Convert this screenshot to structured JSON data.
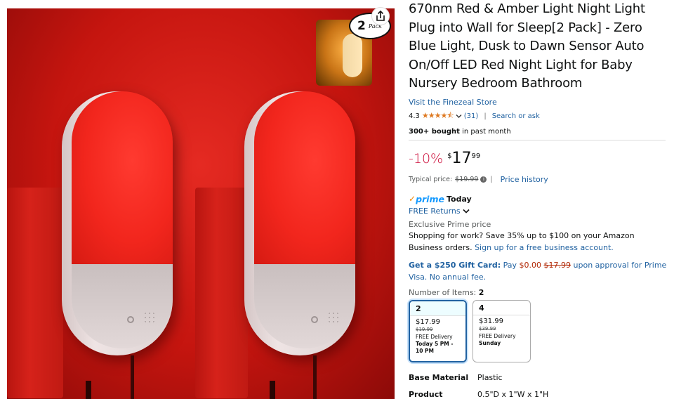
{
  "gallery": {
    "badge_number": "2",
    "badge_word": "Pack",
    "share_icon": "share-icon"
  },
  "product": {
    "title": "670nm Red & Amber Light Night Light Plug into Wall for Sleep[2 Pack] - Zero Blue Light, Dusk to Dawn Sensor Auto On/Off LED Red Night Light for Baby Nursery Bedroom Bathroom",
    "store_link": "Visit the Finezeal Store",
    "rating_value": "4.3",
    "rating_stars": "★★★★⯪",
    "rating_count": "(31)",
    "search_ask": "Search or ask",
    "bought_bold": "300+ bought",
    "bought_rest": " in past month"
  },
  "pricing": {
    "discount": "-10%",
    "currency": "$",
    "whole": "17",
    "fraction": "99",
    "typical_label": "Typical price:",
    "typical_value": "$19.99",
    "price_history": "Price history"
  },
  "delivery": {
    "prime_check": "✓",
    "prime_word": "prime",
    "prime_today": "Today",
    "free_returns": "FREE Returns",
    "exclusive": "Exclusive Prime price",
    "business_text": "Shopping for work? Save 35% up to $100 on your Amazon Business orders.",
    "business_link": "Sign up for a free business account.",
    "gift_bold": "Get a $250 Gift Card:",
    "gift_pay": " Pay ",
    "gift_new": "$0.00",
    "gift_old": "$17.99",
    "gift_rest": " upon approval for Prime Visa. No annual fee."
  },
  "variations": {
    "label": "Number of Items:",
    "selected": "2",
    "options": [
      {
        "name": "2",
        "price": "$17.99",
        "old": "$19.99",
        "delivery": "FREE Delivery",
        "when": "Today 5 PM - 10 PM"
      },
      {
        "name": "4",
        "price": "$31.99",
        "old": "$39.99",
        "delivery": "FREE Delivery",
        "when": "Sunday"
      }
    ]
  },
  "specs": [
    {
      "key": "Base Material",
      "value": "Plastic"
    },
    {
      "key": "Product Dimensions",
      "value": "0.5\"D x 1\"W x 1\"H"
    }
  ],
  "colors": {
    "link": "#2162a1",
    "deal_red": "#cc0c39",
    "prime_blue": "#1399ff",
    "star_orange": "#de7921"
  }
}
